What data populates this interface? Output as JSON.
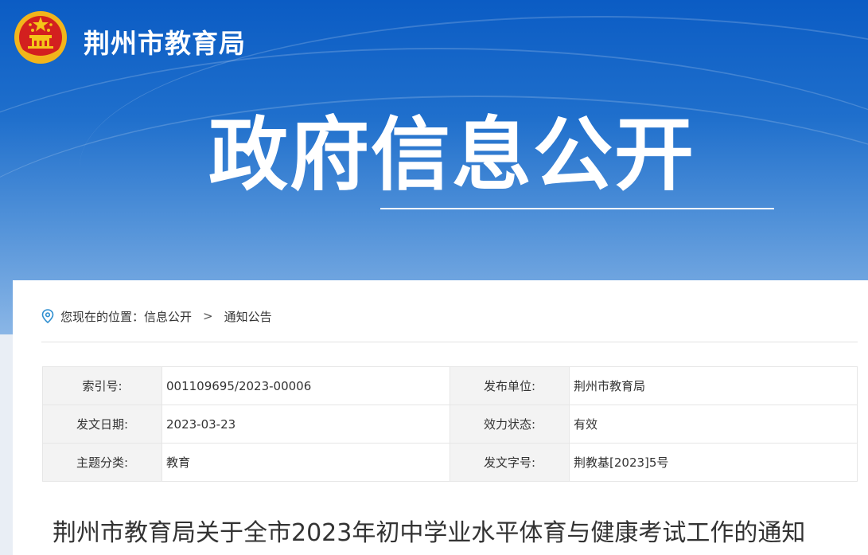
{
  "header": {
    "site_name": "荆州市教育局",
    "section_title": "政府信息公开"
  },
  "breadcrumb": {
    "prefix": "您现在的位置：",
    "items": [
      "信息公开",
      "通知公告"
    ],
    "separator": ">"
  },
  "meta": {
    "rows": [
      {
        "label1": "索引号:",
        "value1": "001109695/2023-00006",
        "label2": "发布单位:",
        "value2": "荆州市教育局"
      },
      {
        "label1": "发文日期:",
        "value1": "2023-03-23",
        "label2": "效力状态:",
        "value2": "有效"
      },
      {
        "label1": "主题分类:",
        "value1": "教育",
        "label2": "发文字号:",
        "value2": "荆教基[2023]5号"
      }
    ]
  },
  "article": {
    "title": "荆州市教育局关于全市2023年初中学业水平体育与健康考试工作的通知"
  },
  "colors": {
    "banner_top": "#0b5cc4",
    "banner_bottom": "#8ab6e6",
    "icon_accent": "#2f8fd0"
  }
}
